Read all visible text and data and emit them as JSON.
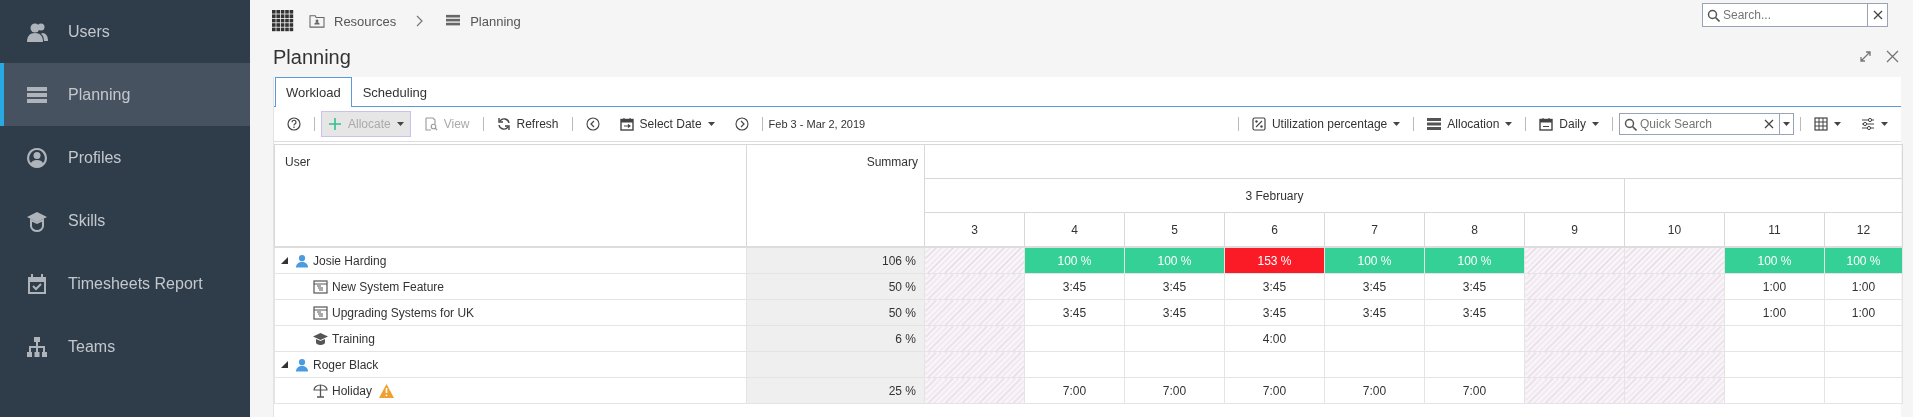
{
  "sidebar": {
    "items": [
      {
        "label": "Users",
        "selected": false
      },
      {
        "label": "Planning",
        "selected": true
      },
      {
        "label": "Profiles",
        "selected": false
      },
      {
        "label": "Skills",
        "selected": false
      },
      {
        "label": "Timesheets Report",
        "selected": false
      },
      {
        "label": "Teams",
        "selected": false
      }
    ]
  },
  "breadcrumb": [
    "Resources",
    "Planning"
  ],
  "search": {
    "placeholder": "Search..."
  },
  "page_title": "Planning",
  "tabs": [
    {
      "label": "Workload",
      "selected": true
    },
    {
      "label": "Scheduling",
      "selected": false
    }
  ],
  "toolbar": {
    "allocate": {
      "label": "Allocate",
      "disabled": true,
      "focused": true
    },
    "view": {
      "label": "View",
      "disabled": true
    },
    "refresh": {
      "label": "Refresh",
      "disabled": false
    },
    "select_date": {
      "label": "Select Date"
    },
    "date_range": "Feb 3 - Mar 2, 2019",
    "utilization": {
      "label": "Utilization percentage"
    },
    "allocation": {
      "label": "Allocation"
    },
    "period": {
      "label": "Daily"
    },
    "quick_search": {
      "placeholder": "Quick Search"
    }
  },
  "grid": {
    "columns": {
      "user": "User",
      "summary": "Summary"
    },
    "weeks": [
      "3 February"
    ],
    "days": [
      {
        "label": "3",
        "weekend": true
      },
      {
        "label": "4",
        "weekend": false
      },
      {
        "label": "5",
        "weekend": false
      },
      {
        "label": "6",
        "weekend": false
      },
      {
        "label": "7",
        "weekend": false
      },
      {
        "label": "8",
        "weekend": false
      },
      {
        "label": "9",
        "weekend": true
      },
      {
        "label": "10",
        "weekend": true
      },
      {
        "label": "11",
        "weekend": false
      },
      {
        "label": "12",
        "weekend": false
      }
    ],
    "rows": [
      {
        "kind": "user",
        "name": "Josie Harding",
        "expanded": true,
        "summary": "106 %",
        "cells": [
          null,
          {
            "text": "100 %",
            "overloaded": false
          },
          {
            "text": "100 %",
            "overloaded": false
          },
          {
            "text": "153 %",
            "overloaded": true
          },
          {
            "text": "100 %",
            "overloaded": false
          },
          {
            "text": "100 %",
            "overloaded": false
          },
          null,
          null,
          {
            "text": "100 %",
            "overloaded": false
          },
          {
            "text": "100 %",
            "overloaded": false
          }
        ],
        "children": [
          {
            "kind": "project",
            "name": "New System Feature",
            "summary": "50 %",
            "cells": [
              null,
              {
                "text": "3:45"
              },
              {
                "text": "3:45"
              },
              {
                "text": "3:45"
              },
              {
                "text": "3:45"
              },
              {
                "text": "3:45"
              },
              null,
              null,
              {
                "text": "1:00"
              },
              {
                "text": "1:00"
              }
            ]
          },
          {
            "kind": "project",
            "name": "Upgrading Systems for UK",
            "summary": "50 %",
            "cells": [
              null,
              {
                "text": "3:45"
              },
              {
                "text": "3:45"
              },
              {
                "text": "3:45"
              },
              {
                "text": "3:45"
              },
              {
                "text": "3:45"
              },
              null,
              null,
              {
                "text": "1:00"
              },
              {
                "text": "1:00"
              }
            ]
          },
          {
            "kind": "training",
            "name": "Training",
            "summary": "6 %",
            "cells": [
              null,
              null,
              null,
              {
                "text": "4:00"
              },
              null,
              null,
              null,
              null,
              null,
              null
            ]
          }
        ]
      },
      {
        "kind": "user",
        "name": "Roger Black",
        "expanded": true,
        "cells": [
          null,
          null,
          null,
          null,
          null,
          null,
          null,
          null,
          null,
          null
        ],
        "children": [
          {
            "kind": "holiday",
            "name": "Holiday",
            "warning": true,
            "summary": "25 %",
            "cells": [
              null,
              {
                "text": "7:00"
              },
              {
                "text": "7:00"
              },
              {
                "text": "7:00"
              },
              {
                "text": "7:00"
              },
              {
                "text": "7:00"
              },
              null,
              null,
              null,
              null
            ]
          }
        ]
      }
    ]
  }
}
